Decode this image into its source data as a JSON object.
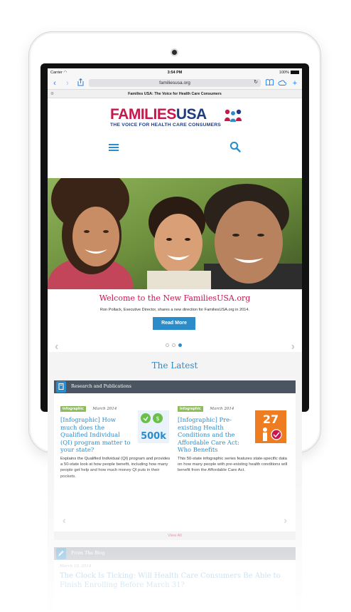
{
  "status_bar": {
    "carrier": "Carrier",
    "time": "3:54 PM",
    "battery": "100%"
  },
  "browser": {
    "url": "familiesusa.org",
    "page_title": "Families USA: The Voice for Health Care Consumers"
  },
  "site": {
    "logo_families": "FAMILIES",
    "logo_usa": "USA",
    "logo_tagline": "THE VOICE FOR HEALTH CARE CONSUMERS"
  },
  "hero": {
    "title": "Welcome to the New FamiliesUSA.org",
    "text": "Ron Pollack, Executive Director, shares a new direction for FamiliesUSA.org in 2014.",
    "button": "Read More",
    "active_slide": 3,
    "slide_count": 3
  },
  "latest": {
    "title": "The Latest",
    "research_heading": "Research and Publications",
    "cards": [
      {
        "tag": "Infographic",
        "date": "March 2014",
        "title": "[Infographic] How much does the Qualified Individual (QI) program matter to your state?",
        "thumb_text": "500k",
        "body": "Explains the Qualified Individual (QI) program and provides a 50-state look at how people benefit, including how many people get help and how much money QI puts in their pockets."
      },
      {
        "tag": "Infographic",
        "date": "March 2014",
        "title": "[Infographic] Pre-existing Health Conditions and the Affordable Care Act: Who Benefits",
        "thumb_text": "27",
        "body": "This 50-state infographic series features state-specific data on how many people with pre-existing health conditions will benefit from the Affordable Care Act."
      }
    ],
    "view_all": "View All",
    "blog_heading": "From The Blog",
    "blog_date": "March 10, 2014",
    "blog_title": "The Clock Is Ticking: Will Health Care Consumers Be Able to Finish Enrolling Before March 31?"
  },
  "colors": {
    "brand_red": "#c8174d",
    "brand_blue": "#2c8cca",
    "navy": "#1f3b84",
    "green_tag": "#8dbd5a"
  }
}
